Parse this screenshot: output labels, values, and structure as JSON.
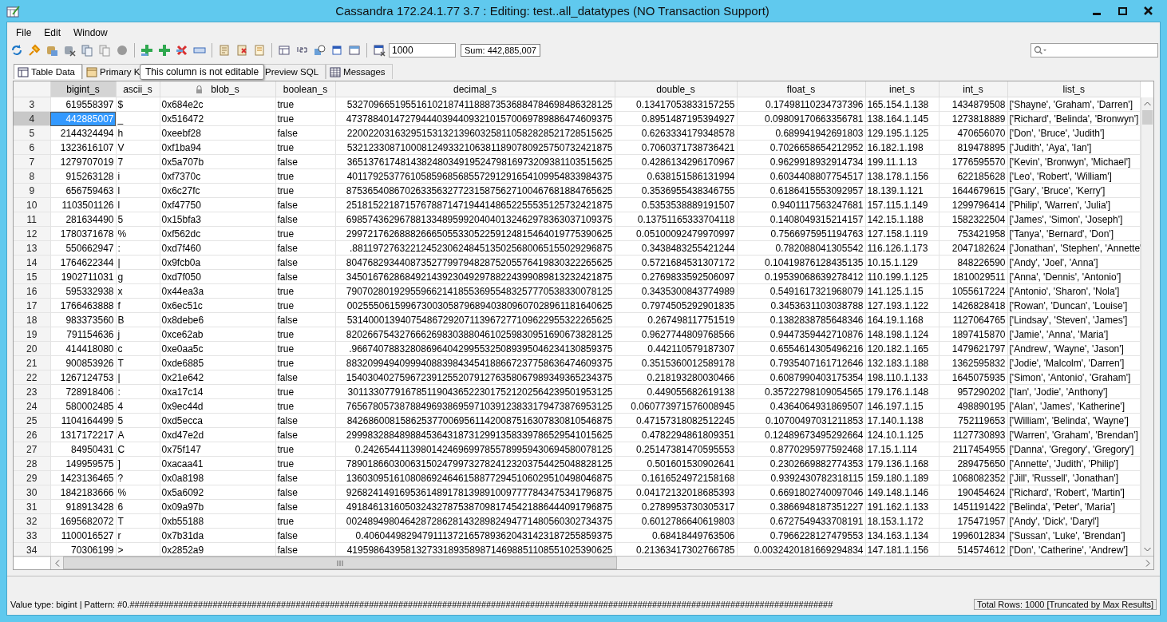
{
  "window": {
    "title": "Cassandra 172.24.1.77 3.7 : Editing: test..all_datatypes (NO Transaction Support)"
  },
  "menu": [
    "File",
    "Edit",
    "Window"
  ],
  "toolbar": {
    "max_rows": "1000",
    "sum": "Sum: 442,885,007"
  },
  "tabs": [
    {
      "label": "Table Data",
      "selected": true
    },
    {
      "label": "Primary K",
      "selected": false
    },
    {
      "label": "Preview SQL",
      "selected": false
    },
    {
      "label": "Messages",
      "selected": false
    }
  ],
  "tooltip": "This column is not editable",
  "table": {
    "columns": [
      {
        "label": "bigint_s",
        "selected": true,
        "locked": false
      },
      {
        "label": "ascii_s",
        "selected": false,
        "locked": false
      },
      {
        "label": "blob_s",
        "selected": false,
        "locked": true
      },
      {
        "label": "boolean_s",
        "selected": false,
        "locked": false
      },
      {
        "label": "decimal_s",
        "selected": false,
        "locked": false
      },
      {
        "label": "double_s",
        "selected": false,
        "locked": false
      },
      {
        "label": "float_s",
        "selected": false,
        "locked": false
      },
      {
        "label": "inet_s",
        "selected": false,
        "locked": false
      },
      {
        "label": "int_s",
        "selected": false,
        "locked": false
      },
      {
        "label": "list_s",
        "selected": false,
        "locked": false
      }
    ],
    "rows": [
      {
        "number": "3",
        "selected": false,
        "cells": [
          "619558397",
          "$",
          "0x684e2c",
          "true",
          "53270966519551610218741188873536884784698486328125",
          "0.13417053833157255",
          "0.17498110234737396",
          "165.154.1.138",
          "1434879508",
          "['Shayne', 'Graham', 'Darren']"
        ]
      },
      {
        "number": "4",
        "selected": true,
        "cells": [
          "442885007",
          "_",
          "0x516472",
          "true",
          "47378840147279444039440932101570069789886474609375",
          "0.8951487195394927",
          "0.09809170663356781",
          "138.164.1.145",
          "1273818889",
          "['Richard', 'Belinda', 'Bronwyn']"
        ]
      },
      {
        "number": "5",
        "selected": false,
        "cells": [
          "2144324494",
          "h",
          "0xeebf28",
          "false",
          "22002203163295153132139603258110582828521728515625",
          "0.6263334179348578",
          "0.689941942691803",
          "129.195.1.125",
          "470656070",
          "['Don', 'Bruce', 'Judith']"
        ]
      },
      {
        "number": "6",
        "selected": false,
        "cells": [
          "1323616107",
          "V",
          "0xf1ba94",
          "true",
          "53212330871000812493321063811890780925750732421875",
          "0.7060371738736421",
          "0.7026658654212952",
          "16.182.1.198",
          "819478895",
          "['Judith', 'Aya', 'Ian']"
        ]
      },
      {
        "number": "7",
        "selected": false,
        "cells": [
          "1279707019",
          "7",
          "0x5a707b",
          "false",
          "36513761748143824803491952479816973209381103515625",
          "0.4286134296170967",
          "0.9629918932914734",
          "199.11.1.13",
          "1776595570",
          "['Kevin', 'Bronwyn', 'Michael']"
        ]
      },
      {
        "number": "8",
        "selected": false,
        "cells": [
          "915263128",
          "i",
          "0xf7370c",
          "true",
          "40117925377610585968568557291291654109954833984375",
          "0.638151586131994",
          "0.6034408807754517",
          "138.178.1.156",
          "622185628",
          "['Leo', 'Robert', 'William']"
        ]
      },
      {
        "number": "9",
        "selected": false,
        "cells": [
          "656759463",
          "l",
          "0x6c27fc",
          "true",
          "87536540867026335632772315875627100467681884765625",
          "0.3536955438346755",
          "0.6186415553092957",
          "18.139.1.121",
          "1644679615",
          "['Gary', 'Bruce', 'Kerry']"
        ]
      },
      {
        "number": "10",
        "selected": false,
        "cells": [
          "1103501126",
          "l",
          "0xf47750",
          "false",
          "25181522187157678871471944148652255535125732421875",
          "0.5353538889191507",
          "0.9401117563247681",
          "157.115.1.149",
          "1299796414",
          "['Philip', 'Warren', 'Julia']"
        ]
      },
      {
        "number": "11",
        "selected": false,
        "cells": [
          "281634490",
          "5",
          "0x15bfa3",
          "false",
          "69857436296788133489599204040132462978363037109375",
          "0.13751165333704118",
          "0.1408049315214157",
          "142.15.1.188",
          "1582322504",
          "['James', 'Simon', 'Joseph']"
        ]
      },
      {
        "number": "12",
        "selected": false,
        "cells": [
          "1780371678",
          "%",
          "0xf562dc",
          "true",
          "29972176268882666505533052259124815464019775390625",
          "0.05100092479970997",
          "0.7566975951194763",
          "127.158.1.119",
          "753421958",
          "['Tanya', 'Bernard', 'Don']"
        ]
      },
      {
        "number": "13",
        "selected": false,
        "cells": [
          "550662947",
          ":",
          "0xd7f460",
          "false",
          ".8811972763221245230624845135025680065155029296875",
          "0.3438483255421244",
          "0.782088041305542",
          "116.126.1.173",
          "2047182624",
          "['Jonathan', 'Stephen', 'Annette'"
        ]
      },
      {
        "number": "14",
        "selected": false,
        "cells": [
          "1764622344",
          "|",
          "0x9fcb0a",
          "false",
          "80476829344087352779979482875205576419830322265625",
          "0.5721684531307172",
          "0.10419876128435135",
          "10.15.1.129",
          "848226590",
          "['Andy', 'Joel', 'Anna']"
        ]
      },
      {
        "number": "15",
        "selected": false,
        "cells": [
          "1902711031",
          "g",
          "0xd7f050",
          "false",
          "34501676286849214392304929788224399089813232421875",
          "0.2769833592506097",
          "0.19539068639278412",
          "110.199.1.125",
          "1810029511",
          "['Anna', 'Dennis', 'Antonio']"
        ]
      },
      {
        "number": "16",
        "selected": false,
        "cells": [
          "595332938",
          "x",
          "0x44ea3a",
          "true",
          "79070280192955966214185536955483257770538330078125",
          "0.3435300843774989",
          "0.5491617321968079",
          "141.125.1.15",
          "1055617224",
          "['Antonio', 'Sharon', 'Nola']"
        ]
      },
      {
        "number": "17",
        "selected": false,
        "cells": [
          "1766463888",
          "f",
          "0x6ec51c",
          "true",
          "00255506159967300305879689403809607028961181640625",
          "0.7974505292901835",
          "0.3453631103038788",
          "127.193.1.122",
          "1426828418",
          "['Rowan', 'Duncan', 'Louise']"
        ]
      },
      {
        "number": "18",
        "selected": false,
        "cells": [
          "983373560",
          "B",
          "0x8debe6",
          "false",
          "53140001394075486729207113967277109622955322265625",
          "0.267498117751519",
          "0.1382838785648346",
          "164.19.1.168",
          "1127064765",
          "['Lindsay', 'Steven', 'James']"
        ]
      },
      {
        "number": "19",
        "selected": false,
        "cells": [
          "791154636",
          "j",
          "0xce62ab",
          "true",
          "82026675432766626983038804610259830951690673828125",
          "0.9627744809768566",
          "0.9447359442710876",
          "148.198.1.124",
          "1897415870",
          "['Jamie', 'Anna', 'Maria']"
        ]
      },
      {
        "number": "20",
        "selected": false,
        "cells": [
          "414418080",
          "c",
          "0xe0aa5c",
          "true",
          ".9667407883280869640429955325089395046234130859375",
          "0.442110579187307",
          "0.6554614305496216",
          "120.182.1.165",
          "1479621797",
          "['Andrew', 'Wayne', 'Jason']"
        ]
      },
      {
        "number": "21",
        "selected": false,
        "cells": [
          "900853926",
          "T",
          "0xde6885",
          "true",
          "88320994940999408839843454188667237758636474609375",
          "0.3515360012589178",
          "0.7935407161712646",
          "132.183.1.188",
          "1362595832",
          "['Jodie', 'Malcolm', 'Darren']"
        ]
      },
      {
        "number": "22",
        "selected": false,
        "cells": [
          "1267124753",
          "|",
          "0x21e642",
          "false",
          "15403040275967239125520791276358067989349365234375",
          "0.218193280030466",
          "0.6087990403175354",
          "198.110.1.133",
          "1645075935",
          "['Simon', 'Antonio', 'Graham']"
        ]
      },
      {
        "number": "23",
        "selected": false,
        "cells": [
          "728918406",
          ":",
          "0xa17c14",
          "true",
          "30113307791678511904365223017521202564239501953125",
          "0.449055682619138",
          "0.35722798109054565",
          "179.176.1.148",
          "957290202",
          "['Ian', 'Jodie', 'Anthony']"
        ]
      },
      {
        "number": "24",
        "selected": false,
        "cells": [
          "580002485",
          "4",
          "0x9ec44d",
          "true",
          "76567805738788496938695971039123833179473876953125",
          "0.060773971576008945",
          "0.4364064931869507",
          "146.197.1.15",
          "498890195",
          "['Alan', 'James', 'Katherine']"
        ]
      },
      {
        "number": "25",
        "selected": false,
        "cells": [
          "1104164499",
          "5",
          "0xd5ecca",
          "false",
          "84268600815862537700695611420087516307830810546875",
          "0.47157318082512245",
          "0.10700497031211853",
          "17.140.1.138",
          "752119653",
          "['William', 'Belinda', 'Wayne']"
        ]
      },
      {
        "number": "26",
        "selected": false,
        "cells": [
          "1317172217",
          "A",
          "0xd47e2d",
          "false",
          "29998328848988453643187312991358339786529541015625",
          "0.4782294861809351",
          "0.12489673495292664",
          "124.10.1.125",
          "1127730893",
          "['Warren', 'Graham', 'Brendan']"
        ]
      },
      {
        "number": "27",
        "selected": false,
        "cells": [
          "84950431",
          "C",
          "0x75f147",
          "true",
          "0.24265441139801424696997855789959430694580078125",
          "0.25147381470595553",
          "0.8770295977592468",
          "17.15.1.114",
          "2117454955",
          "['Danna', 'Gregory', 'Gregory']"
        ]
      },
      {
        "number": "28",
        "selected": false,
        "cells": [
          "149959575",
          "]",
          "0xacaa41",
          "true",
          "78901866030063150247997327824123203754425048828125",
          "0.501601530902641",
          "0.2302669882774353",
          "179.136.1.168",
          "289475650",
          "['Annette', 'Judith', 'Philip']"
        ]
      },
      {
        "number": "29",
        "selected": false,
        "cells": [
          "1423136465",
          "?",
          "0x0a8198",
          "false",
          "13603095161080869246461588772945106029510498046875",
          "0.1616524972158168",
          "0.9392430782318115",
          "159.180.1.189",
          "1068082352",
          "['Jill', 'Russell', 'Jonathan']"
        ]
      },
      {
        "number": "30",
        "selected": false,
        "cells": [
          "1842183666",
          "%",
          "0x5a6092",
          "false",
          "92682414916953614891781398910097777843475341796875",
          "0.04172132018685393",
          "0.6691802740097046",
          "149.148.1.146",
          "190454624",
          "['Richard', 'Robert', 'Martin']"
        ]
      },
      {
        "number": "31",
        "selected": false,
        "cells": [
          "918913428",
          "6",
          "0x09a97b",
          "false",
          "49184613160503243278753870981745421886444091796875",
          "0.2789953730305317",
          "0.3866948187351227",
          "191.162.1.133",
          "1451191422",
          "['Belinda', 'Peter', 'Maria']"
        ]
      },
      {
        "number": "32",
        "selected": false,
        "cells": [
          "1695682072",
          "T",
          "0xb55188",
          "true",
          "00248949804642872862814328982494771480560302734375",
          "0.6012786640619803",
          "0.6727549433708191",
          "18.153.1.172",
          "175471957",
          "['Andy', 'Dick', 'Daryl']"
        ]
      },
      {
        "number": "33",
        "selected": false,
        "cells": [
          "1100016527",
          "r",
          "0x7b31da",
          "false",
          "0.40604498294791113721657893620431423187255859375",
          "0.68418449763506",
          "0.7966228127479553",
          "134.163.1.134",
          "1996012834",
          "['Sussan', 'Luke', 'Brendan']"
        ]
      },
      {
        "number": "34",
        "selected": false,
        "cells": [
          "70306199",
          ">",
          "0x2852a9",
          "false",
          "41959864395813273318935898714698851108551025390625",
          "0.21363417302766785",
          "0.0032420181669294834",
          "147.181.1.156",
          "514574612",
          "['Don', 'Catherine', 'Andrew']"
        ]
      }
    ]
  },
  "status_bar": {
    "info": "Value type: bigint | Pattern: #0.################################################################################################################################################",
    "total": "Total Rows: 1000  [Truncated by Max Results]"
  }
}
